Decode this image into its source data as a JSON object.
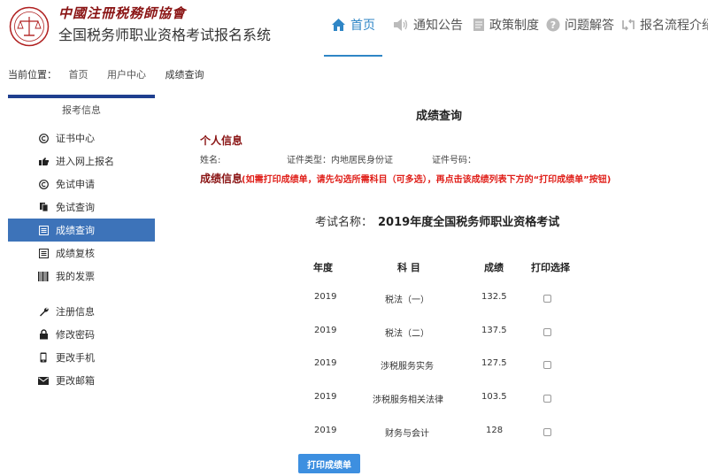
{
  "header": {
    "org_name": "中國注冊税務師協會",
    "system_name": "全国税务师职业资格考试报名系统",
    "nav": [
      {
        "label": "首页",
        "icon": "home-icon",
        "active": true
      },
      {
        "label": "通知公告",
        "icon": "speaker-icon"
      },
      {
        "label": "政策制度",
        "icon": "document-icon"
      },
      {
        "label": "问题解答",
        "icon": "question-icon"
      },
      {
        "label": "报名流程介绍",
        "icon": "flow-icon"
      }
    ]
  },
  "breadcrumb": {
    "prefix": "当前位置：",
    "items": [
      "首页",
      "用户中心",
      "成绩查询"
    ]
  },
  "sidebar": {
    "title": "报考信息",
    "items": [
      {
        "label": "证书中心",
        "icon": "certificate-icon"
      },
      {
        "label": "进入网上报名",
        "icon": "hand-pointer-icon"
      },
      {
        "label": "免试申请",
        "icon": "circle-c-icon"
      },
      {
        "label": "免试查询",
        "icon": "copy-icon"
      },
      {
        "label": "成绩查询",
        "icon": "list-icon",
        "active": true
      },
      {
        "label": "成绩复核",
        "icon": "list-box-icon"
      },
      {
        "label": "我的发票",
        "icon": "barcode-icon"
      },
      {
        "label": "注册信息",
        "icon": "wrench-icon"
      },
      {
        "label": "修改密码",
        "icon": "lock-icon"
      },
      {
        "label": "更改手机",
        "icon": "phone-icon"
      },
      {
        "label": "更改邮箱",
        "icon": "envelope-icon"
      }
    ]
  },
  "main": {
    "title": "成绩查询",
    "personal_title": "个人信息",
    "name_label": "姓名:",
    "id_type_label": "证件类型：内地居民身份证",
    "id_number_label": "证件号码：",
    "score_title": "成绩信息",
    "score_notice": "(如需打印成绩单，请先勾选所需科目（可多选），再点击该成绩列表下方的“打印成绩单”按钮)",
    "exam_label": "考试名称：",
    "exam_name": "2019年度全国税务师职业资格考试",
    "table": {
      "headers": [
        "年度",
        "科 目",
        "成绩",
        "打印选择"
      ],
      "rows": [
        {
          "year": "2019",
          "subject": "税法（一）",
          "score": "132.5",
          "checked": false
        },
        {
          "year": "2019",
          "subject": "税法（二）",
          "score": "137.5",
          "checked": false
        },
        {
          "year": "2019",
          "subject": "涉税服务实务",
          "score": "127.5",
          "checked": false
        },
        {
          "year": "2019",
          "subject": "涉税服务相关法律",
          "score": "103.5",
          "checked": false
        },
        {
          "year": "2019",
          "subject": "财务与会计",
          "score": "128",
          "checked": false
        }
      ]
    },
    "print_button": "打印成绩单"
  },
  "colors": {
    "accent": "#2f86c6",
    "sidebar_active": "#3d73b9",
    "sidebar_top_bar": "#1f3f8f",
    "section_title": "#8a1414",
    "notice": "#e0201a",
    "print_button": "#3d8fe0"
  }
}
